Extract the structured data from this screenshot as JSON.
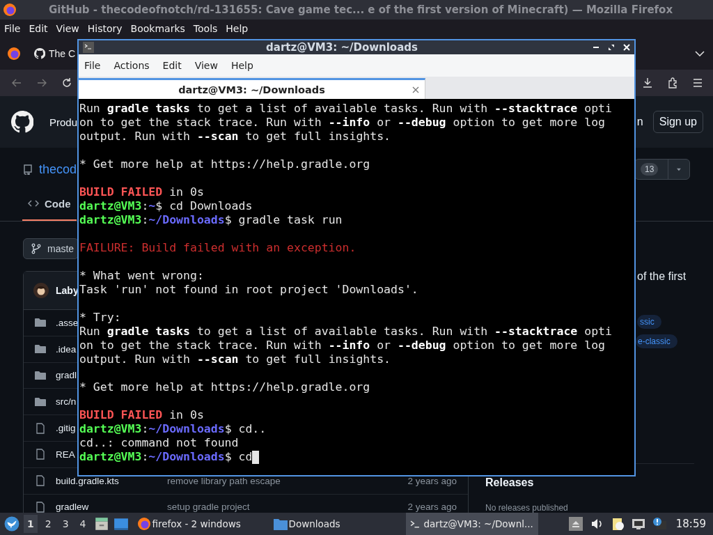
{
  "firefox": {
    "title": "GitHub - thecodeofnotch/rd-131655: Cave game tec...  e of the first version of Minecraft) — Mozilla Firefox",
    "menu": [
      "File",
      "Edit",
      "View",
      "History",
      "Bookmarks",
      "Tools",
      "Help"
    ],
    "tab": {
      "label": "The C"
    },
    "page": {
      "header": {
        "nav_item": "Produ",
        "sign_in": "n",
        "sign_up": "Sign up"
      },
      "repo": {
        "name": "thecod",
        "count": "13"
      },
      "tabs": [
        {
          "label": "Code",
          "selected": true
        }
      ],
      "branch": "maste",
      "commit_author": "Laby",
      "files": [
        {
          "kind": "folder",
          "name": ".asse"
        },
        {
          "kind": "folder",
          "name": ".idea"
        },
        {
          "kind": "folder",
          "name": "gradl"
        },
        {
          "kind": "folder",
          "name": "src/n"
        },
        {
          "kind": "file",
          "name": ".gitig"
        },
        {
          "kind": "file",
          "name": "REA"
        },
        {
          "kind": "file",
          "name": "build.gradle.kts",
          "message": "remove library path escape",
          "date": "2 years ago"
        },
        {
          "kind": "file",
          "name": "gradlew",
          "message": "setup gradle project",
          "date": "2 years ago"
        }
      ],
      "about": "of the first",
      "topics": [
        "ssic",
        "e-classic"
      ],
      "releases": {
        "title": "Releases",
        "note": "No releases published"
      }
    }
  },
  "terminal": {
    "title": "dartz@VM3: ~/Downloads",
    "menu": [
      "File",
      "Actions",
      "Edit",
      "View",
      "Help"
    ],
    "tab": {
      "label": "dartz@VM3: ~/Downloads",
      "selected": true
    },
    "cursor": true,
    "lines": [
      {
        "kind": "text",
        "segments": [
          {
            "kind": "rich",
            "text": "Run **gradle tasks** to get a list of available tasks. Run with **--stacktrace** opti"
          }
        ]
      },
      {
        "kind": "text",
        "segments": [
          {
            "kind": "rich",
            "text": "on to get the stack trace. Run with **--info** or **--debug** option to get more log"
          }
        ]
      },
      {
        "kind": "text",
        "segments": [
          {
            "kind": "rich",
            "text": "output. Run with **--scan** to get full insights."
          }
        ]
      },
      {
        "kind": "blank"
      },
      {
        "kind": "text",
        "segments": [
          {
            "kind": "plain",
            "text": "* Get more help at https://help.gradle.org"
          }
        ]
      },
      {
        "kind": "blank"
      },
      {
        "kind": "text",
        "segments": [
          {
            "kind": "error_bold",
            "text": "BUILD FAILED"
          },
          {
            "kind": "plain",
            "text": " in 0s"
          }
        ]
      },
      {
        "kind": "text",
        "segments": [
          {
            "kind": "user",
            "text": "dartz@VM3"
          },
          {
            "kind": "plain",
            "text": ":"
          },
          {
            "kind": "path",
            "text": "~"
          },
          {
            "kind": "plain",
            "text": "$ cd Downloads"
          }
        ]
      },
      {
        "kind": "text",
        "segments": [
          {
            "kind": "user",
            "text": "dartz@VM3"
          },
          {
            "kind": "plain",
            "text": ":"
          },
          {
            "kind": "path",
            "text": "~/Downloads"
          },
          {
            "kind": "plain",
            "text": "$ gradle task run"
          }
        ]
      },
      {
        "kind": "blank"
      },
      {
        "kind": "text",
        "segments": [
          {
            "kind": "error",
            "text": "FAILURE: Build failed with an exception."
          }
        ]
      },
      {
        "kind": "blank"
      },
      {
        "kind": "text",
        "segments": [
          {
            "kind": "plain",
            "text": "* What went wrong:"
          }
        ]
      },
      {
        "kind": "text",
        "segments": [
          {
            "kind": "plain",
            "text": "Task 'run' not found in root project 'Downloads'."
          }
        ]
      },
      {
        "kind": "blank"
      },
      {
        "kind": "text",
        "segments": [
          {
            "kind": "plain",
            "text": "* Try:"
          }
        ]
      },
      {
        "kind": "text",
        "segments": [
          {
            "kind": "rich",
            "text": "Run **gradle tasks** to get a list of available tasks. Run with **--stacktrace** opti"
          }
        ]
      },
      {
        "kind": "text",
        "segments": [
          {
            "kind": "rich",
            "text": "on to get the stack trace. Run with **--info** or **--debug** option to get more log"
          }
        ]
      },
      {
        "kind": "text",
        "segments": [
          {
            "kind": "rich",
            "text": "output. Run with **--scan** to get full insights."
          }
        ]
      },
      {
        "kind": "blank"
      },
      {
        "kind": "text",
        "segments": [
          {
            "kind": "plain",
            "text": "* Get more help at https://help.gradle.org"
          }
        ]
      },
      {
        "kind": "blank"
      },
      {
        "kind": "text",
        "segments": [
          {
            "kind": "error_bold",
            "text": "BUILD FAILED"
          },
          {
            "kind": "plain",
            "text": " in 0s"
          }
        ]
      },
      {
        "kind": "text",
        "segments": [
          {
            "kind": "user",
            "text": "dartz@VM3"
          },
          {
            "kind": "plain",
            "text": ":"
          },
          {
            "kind": "path",
            "text": "~/Downloads"
          },
          {
            "kind": "plain",
            "text": "$ cd.."
          }
        ]
      },
      {
        "kind": "text",
        "segments": [
          {
            "kind": "plain",
            "text": "cd..: command not found"
          }
        ]
      },
      {
        "kind": "text",
        "segments": [
          {
            "kind": "user",
            "text": "dartz@VM3"
          },
          {
            "kind": "plain",
            "text": ":"
          },
          {
            "kind": "path",
            "text": "~/Downloads"
          },
          {
            "kind": "plain",
            "text": "$ cd"
          }
        ]
      }
    ]
  },
  "taskbar": {
    "workspaces": [
      {
        "label": "1",
        "selected": true
      },
      {
        "label": "2",
        "selected": false
      },
      {
        "label": "3",
        "selected": false
      },
      {
        "label": "4",
        "selected": false
      }
    ],
    "tasks": [
      {
        "kind": "firefox",
        "label": "firefox - 2 windows",
        "selected": false
      },
      {
        "kind": "folder",
        "label": "Downloads",
        "selected": false
      },
      {
        "kind": "terminal",
        "label": "dartz@VM3: ~/Downl...",
        "selected": true
      }
    ],
    "clock": "18:59"
  }
}
